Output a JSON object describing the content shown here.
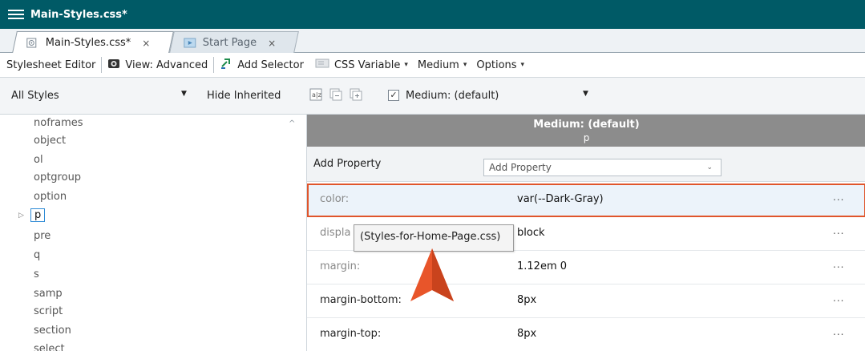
{
  "window": {
    "title": "Main-Styles.css*"
  },
  "tabs": [
    {
      "label": "Main-Styles.css*",
      "close": "×",
      "icon": "css-file-icon"
    },
    {
      "label": "Start Page",
      "close": "×",
      "icon": "start-page-icon"
    }
  ],
  "toolbar": {
    "stylesheet_editor": "Stylesheet Editor",
    "view": "View: Advanced",
    "add_selector": "Add Selector",
    "css_variable": "CSS Variable",
    "medium": "Medium",
    "options": "Options"
  },
  "filterbar": {
    "all_styles": "All Styles",
    "hide_inherited": "Hide Inherited",
    "medium_checkbox_checked": true,
    "medium_label": "Medium: (default)"
  },
  "selectors": [
    "noframes",
    "object",
    "ol",
    "optgroup",
    "option",
    "p",
    "pre",
    "q",
    "s",
    "samp",
    "script",
    "section",
    "select"
  ],
  "selected_selector": "p",
  "panel": {
    "header_medium": "Medium: (default)",
    "header_selector": "p",
    "add_property_label": "Add Property",
    "add_property_placeholder": "Add Property"
  },
  "properties": [
    {
      "name": "color:",
      "value": "var(--Dark-Gray)",
      "more": "..."
    },
    {
      "name": "displa",
      "value": "block",
      "more": "..."
    },
    {
      "name": "margin:",
      "value": "1.12em 0",
      "more": "..."
    },
    {
      "name": "margin-bottom:",
      "value": "8px",
      "more": "..."
    },
    {
      "name": "margin-top:",
      "value": "8px",
      "more": "..."
    }
  ],
  "tooltip": "(Styles-for-Home-Page.css)",
  "colors": {
    "titlebar": "#005a66",
    "highlight_border": "#e0552b",
    "header_gray": "#8c8c8c",
    "arrow": "#e8552a"
  }
}
